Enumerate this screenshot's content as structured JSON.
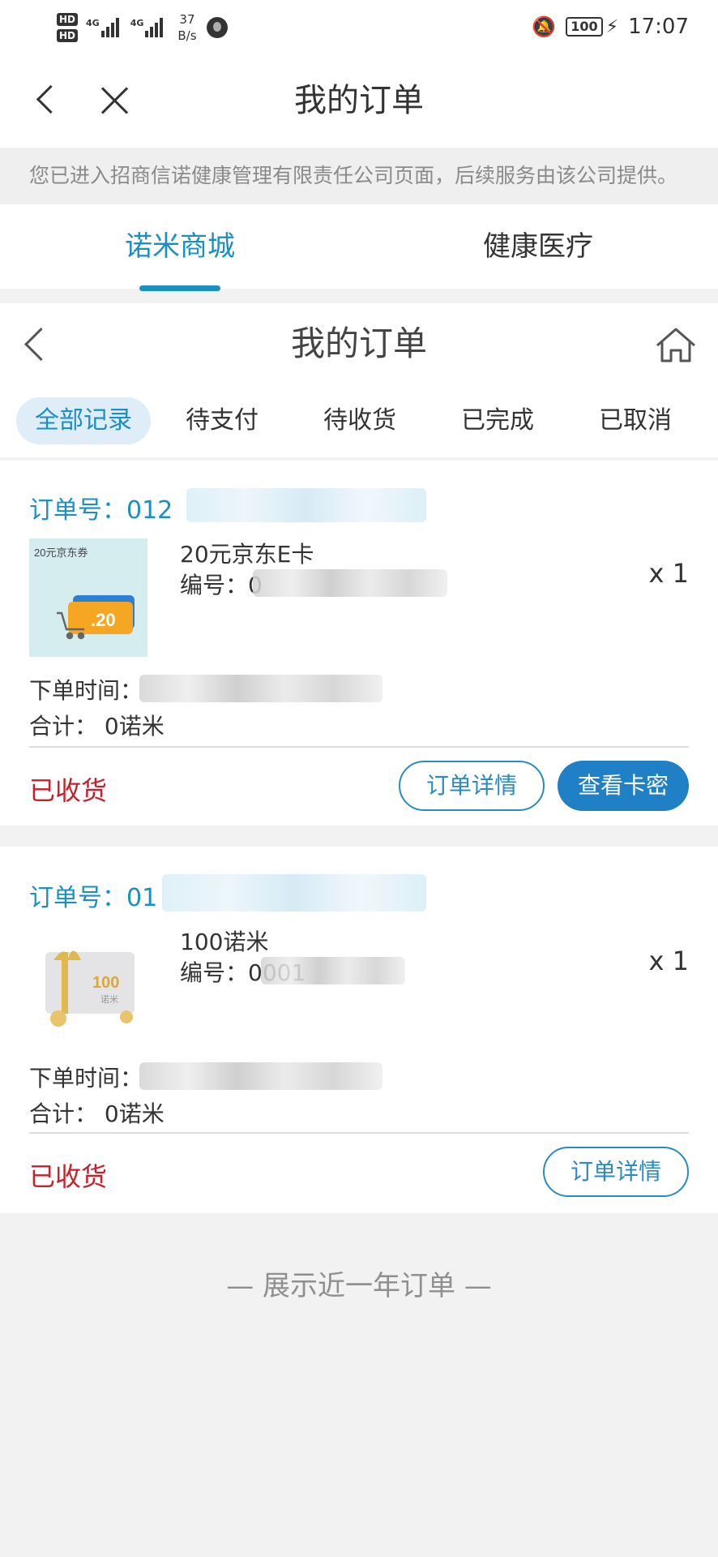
{
  "status_bar": {
    "hd1": "HD",
    "hd2": "HD",
    "net1": "4G",
    "net2": "4G",
    "speed_value": "37",
    "speed_unit": "B/s",
    "battery": "100",
    "time": "17:07"
  },
  "titlebar": {
    "title": "我的订单"
  },
  "notice": "您已进入招商信诺健康管理有限责任公司页面，后续服务由该公司提供。",
  "top_tabs": [
    {
      "label": "诺米商城",
      "active": true
    },
    {
      "label": "健康医疗",
      "active": false
    }
  ],
  "inner_header": {
    "title": "我的订单"
  },
  "filter_tabs": [
    {
      "label": "全部记录",
      "active": true
    },
    {
      "label": "待支付",
      "active": false
    },
    {
      "label": "待收货",
      "active": false
    },
    {
      "label": "已完成",
      "active": false
    },
    {
      "label": "已取消",
      "active": false
    }
  ],
  "orders": [
    {
      "order_no": "订单号：012",
      "thumb_label": "20元京东券",
      "thumb_value": ".20",
      "product_name": "20元京东E卡",
      "code_label": "编号：",
      "code_visible": "0",
      "quantity": "x 1",
      "time_label": "下单时间：",
      "total": "合计：  0诺米",
      "status": "已收货",
      "detail_button": "订单详情",
      "card_button": "查看卡密"
    },
    {
      "order_no": "订单号：01",
      "thumb_value": "100",
      "thumb_unit": "诺米",
      "product_name": "100诺米",
      "code_label": "编号：",
      "code_visible": "0001",
      "quantity": "x 1",
      "time_label": "下单时间：",
      "total": "合计：  0诺米",
      "status": "已收货",
      "detail_button": "订单详情"
    }
  ],
  "footer_note": "— 展示近一年订单 —",
  "colors": {
    "accent": "#1a8fc4",
    "button_blue": "#1f80c6",
    "status_red": "#c8202a",
    "page_bg": "#f2f2f2"
  },
  "icons": [
    "back-icon",
    "close-icon",
    "home-icon",
    "cart-icon",
    "gift-card-icon"
  ]
}
